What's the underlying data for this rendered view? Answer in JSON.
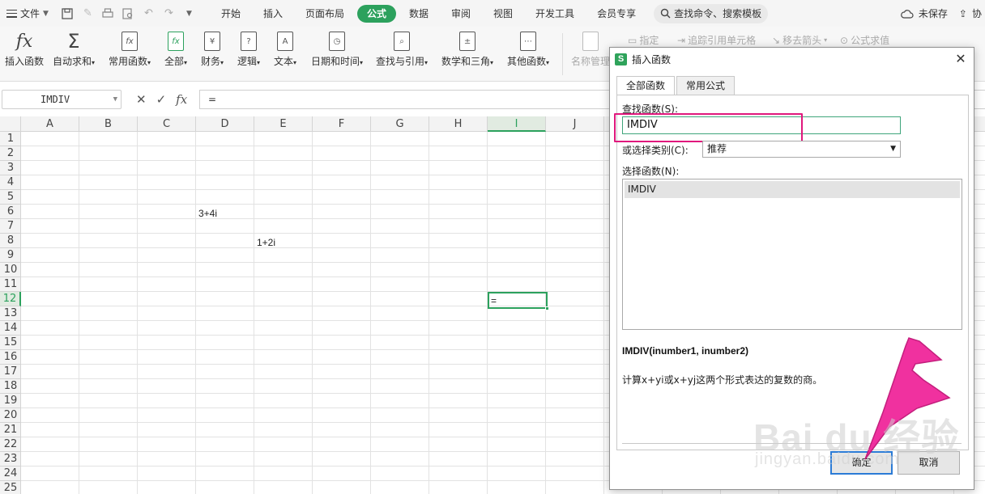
{
  "menubar": {
    "file_label": "文件",
    "tabs": [
      {
        "label": "开始",
        "active": false
      },
      {
        "label": "插入",
        "active": false
      },
      {
        "label": "页面布局",
        "active": false
      },
      {
        "label": "公式",
        "active": true
      },
      {
        "label": "数据",
        "active": false
      },
      {
        "label": "审阅",
        "active": false
      },
      {
        "label": "视图",
        "active": false
      },
      {
        "label": "开发工具",
        "active": false
      },
      {
        "label": "会员专享",
        "active": false
      }
    ],
    "search_label": "查找命令、搜索模板",
    "unsaved_label": "未保存",
    "share_label": "协"
  },
  "ribbon": {
    "insert_function": "插入函数",
    "autosum": "自动求和",
    "common_functions": "常用函数",
    "all": "全部",
    "finance": "财务",
    "logic": "逻辑",
    "text": "文本",
    "datetime": "日期和时间",
    "lookup": "查找与引用",
    "math": "数学和三角",
    "other": "其他函数",
    "name_manager": "名称管理",
    "assign": "指定",
    "trace_precedents": "追踪引用单元格",
    "remove_arrows": "移去箭头",
    "formula_eval": "公式求值"
  },
  "formulabar": {
    "namebox": "IMDIV",
    "formula": "="
  },
  "grid": {
    "columns": [
      "A",
      "B",
      "C",
      "D",
      "E",
      "F",
      "G",
      "H",
      "I",
      "J"
    ],
    "rows": [
      "1",
      "2",
      "3",
      "4",
      "5",
      "6",
      "7",
      "8",
      "9",
      "10",
      "11",
      "12",
      "13",
      "14",
      "15",
      "16",
      "17",
      "18",
      "19",
      "20",
      "21",
      "22",
      "23",
      "24",
      "25"
    ],
    "selected_column": "I",
    "selected_row": "12",
    "cell_d6": "3+4i",
    "cell_e8": "1+2i",
    "cell_i12": "="
  },
  "dialog": {
    "title": "插入函数",
    "tab_all": "全部函数",
    "tab_common": "常用公式",
    "search_label": "查找函数(S):",
    "search_value": "IMDIV",
    "category_label": "或选择类别(C):",
    "category_value": "推荐",
    "select_label": "选择函数(N):",
    "functions": [
      "IMDIV"
    ],
    "syntax": "IMDIV(inumber1, inumber2)",
    "description": "计算x+yi或x+yj这两个形式表达的复数的商。",
    "ok_label": "确定",
    "cancel_label": "取消"
  },
  "watermark": {
    "main": "Bai du 经验",
    "sub": "jingyan.baidu.com"
  },
  "colors": {
    "accent": "#2ca15d",
    "highlight": "#e0187d",
    "arrow": "#f0269a",
    "ok_border": "#2b7bd6"
  }
}
